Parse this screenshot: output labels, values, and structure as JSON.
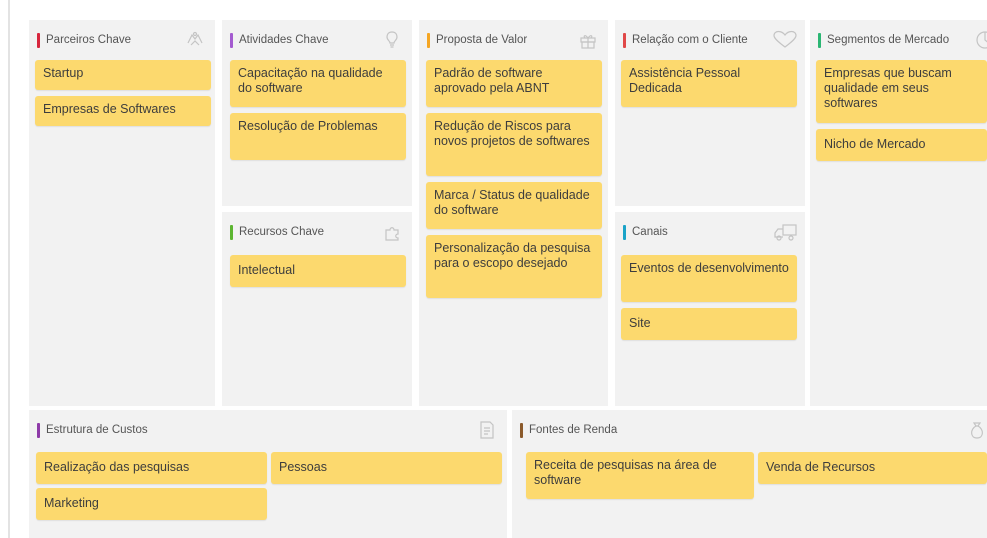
{
  "colors": {
    "note": "#fcd96e",
    "column": "#f2f2f2",
    "accent_parceiros": "#d7263d",
    "accent_atividades": "#a45bd0",
    "accent_recursos": "#5cb531",
    "accent_proposta": "#f5a623",
    "accent_relacao": "#e04848",
    "accent_canais": "#1aa3c8",
    "accent_segmentos": "#2bb673",
    "accent_custos": "#8e3aa8",
    "accent_fontes": "#8b5a2b"
  },
  "sections": {
    "parceiros": {
      "title": "Parceiros Chave",
      "icon": "handshake-icon",
      "notes": [
        "Startup",
        "Empresas de Softwares"
      ]
    },
    "atividades": {
      "title": "Atividades Chave",
      "icon": "lightbulb-icon",
      "notes": [
        "Capacitação na qualidade do software",
        "Resolução de Problemas"
      ]
    },
    "recursos": {
      "title": "Recursos Chave",
      "icon": "puzzle-icon",
      "notes": [
        "Intelectual"
      ]
    },
    "proposta": {
      "title": "Proposta de Valor",
      "icon": "gift-icon",
      "notes": [
        "Padrão de software aprovado pela ABNT",
        "Redução de Riscos para novos projetos de softwares",
        "Marca / Status de qualidade do software",
        "Personalização da pesquisa para o escopo desejado"
      ]
    },
    "relacao": {
      "title": "Relação com o Cliente",
      "icon": "heart-icon",
      "notes": [
        "Assistência Pessoal Dedicada"
      ]
    },
    "canais": {
      "title": "Canais",
      "icon": "truck-icon",
      "notes": [
        "Eventos de desenvolvimento",
        "Site"
      ]
    },
    "segmentos": {
      "title": "Segmentos de Mercado",
      "icon": "pie-chart-icon",
      "notes": [
        "Empresas que buscam qualidade em seus softwares",
        "Nicho de Mercado"
      ]
    },
    "custos": {
      "title": "Estrutura de Custos",
      "icon": "document-icon",
      "notes": [
        "Realização das pesquisas",
        "Pessoas",
        "Marketing"
      ]
    },
    "fontes": {
      "title": "Fontes de Renda",
      "icon": "money-bag-icon",
      "notes": [
        "Receita de pesquisas na área de software",
        "Venda de Recursos"
      ]
    }
  }
}
